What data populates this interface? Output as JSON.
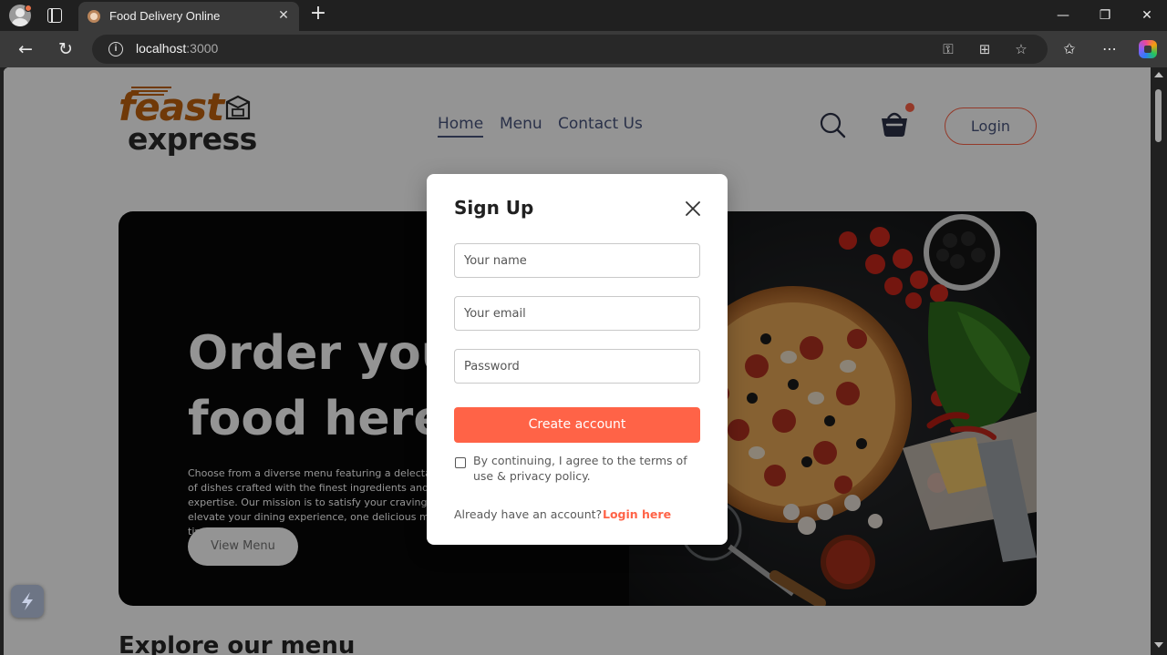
{
  "browser": {
    "tab_title": "Food Delivery Online",
    "url_host": "localhost",
    "url_port": ":3000"
  },
  "site": {
    "logo_top": "feast",
    "logo_bottom": "express",
    "nav": [
      "Home",
      "Menu",
      "Contact Us"
    ],
    "login_label": "Login",
    "hero_title_line1": "Order your",
    "hero_title_line2": "food here",
    "hero_text": "Choose from a diverse menu featuring a delectable array of dishes crafted with the finest ingredients and culinary expertise. Our mission is to satisfy your cravings and elevate your dining experience, one delicious meal at a time.",
    "hero_button": "View Menu",
    "explore_heading": "Explore our menu",
    "accent_color": "#ff6347"
  },
  "modal": {
    "title": "Sign Up",
    "name_placeholder": "Your name",
    "email_placeholder": "Your email",
    "password_placeholder": "Password",
    "create_label": "Create account",
    "terms": "By continuing, I agree to the terms of use & privacy policy.",
    "already": "Already have an account?",
    "login_link": "Login here"
  }
}
